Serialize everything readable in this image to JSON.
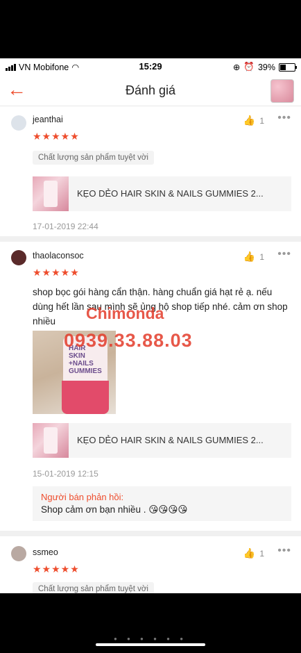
{
  "status_bar": {
    "carrier": "VN Mobifone",
    "time": "15:29",
    "battery": "39%"
  },
  "header": {
    "title": "Đánh giá",
    "back_icon": "back-arrow-icon"
  },
  "reviews": [
    {
      "username": "jeanthai",
      "likes": "1",
      "stars": "★★★★★",
      "tag": "Chất lượng sản phẩm tuyệt vời",
      "product": "KẸO DẺO HAIR SKIN & NAILS GUMMIES 2...",
      "date": "17-01-2019 22:44"
    },
    {
      "username": "thaolaconsoc",
      "likes": "1",
      "stars": "★★★★★",
      "comment": "shop bọc gói hàng cẩn thận. hàng chuẩn giá hạt rẻ ạ. nếu dùng hết lần sau mình sẽ ủng hộ shop tiếp nhé. cảm ơn shop nhiều",
      "photo_text": "HAIR SKIN +NAILS GUMMIES",
      "product": "KẸO DẺO HAIR SKIN & NAILS GUMMIES 2...",
      "date": "15-01-2019 12:15",
      "seller_reply_header": "Người bán phản hồi:",
      "seller_reply": "Shop cảm ơn bạn nhiều . 😘😘😘😘"
    },
    {
      "username": "ssmeo",
      "likes": "1",
      "stars": "★★★★★",
      "tag": "Chất lượng sản phẩm tuyệt vời"
    }
  ],
  "watermark": {
    "name": "Chimonda",
    "phone": "0939.33.88.03"
  },
  "colors": {
    "accent": "#ee4d2d",
    "watermark": "#e33b2a"
  }
}
